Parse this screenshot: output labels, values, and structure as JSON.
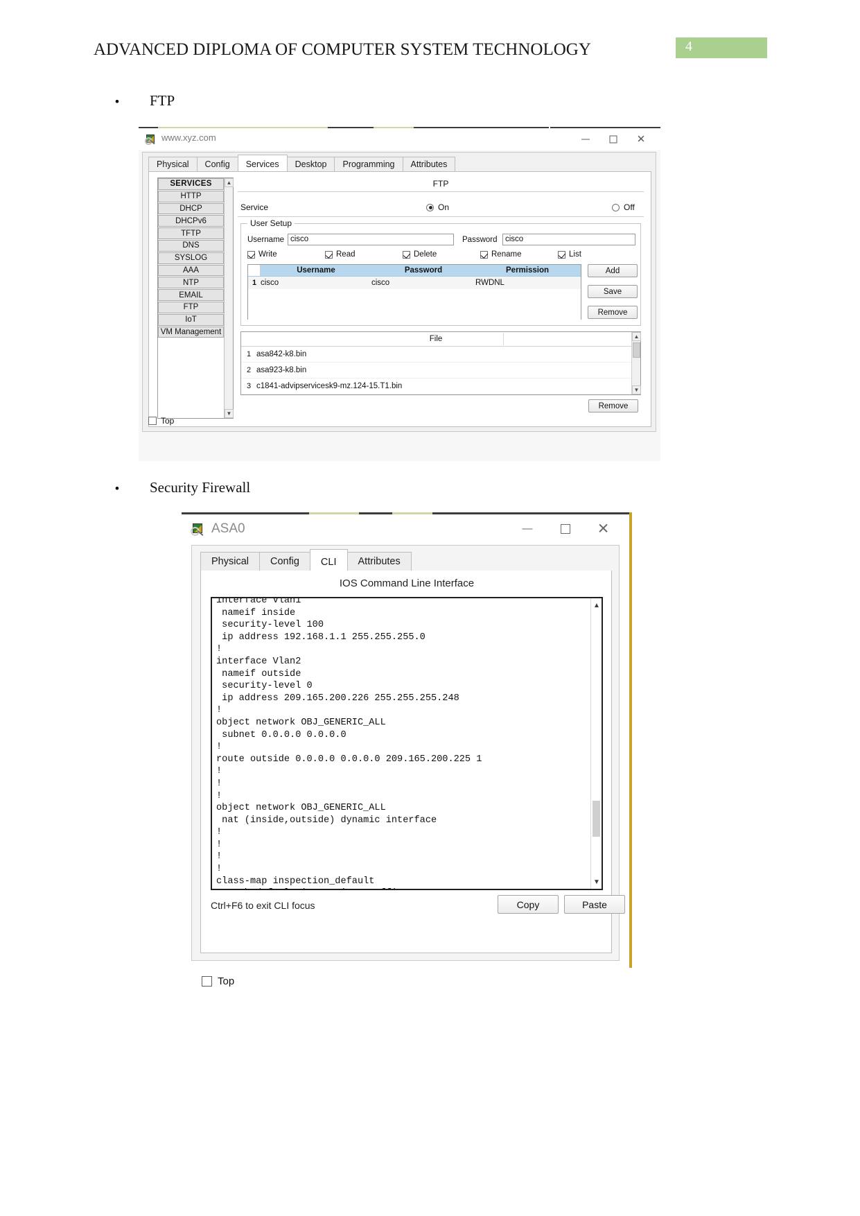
{
  "header": {
    "title": "ADVANCED DIPLOMA OF COMPUTER SYSTEM TECHNOLOGY",
    "page_number": "4",
    "badge_color": "#a9d08e"
  },
  "sections": [
    {
      "bullet": "•",
      "label": "FTP"
    },
    {
      "bullet": "•",
      "label": "Security Firewall"
    }
  ],
  "ftp_window": {
    "caption": "www.xyz.com",
    "window_buttons": {
      "minimize": "–",
      "maximize": "□",
      "close": "✕"
    },
    "tabs": [
      {
        "label": "Physical",
        "active": false
      },
      {
        "label": "Config",
        "active": false
      },
      {
        "label": "Services",
        "active": true
      },
      {
        "label": "Desktop",
        "active": false
      },
      {
        "label": "Programming",
        "active": false
      },
      {
        "label": "Attributes",
        "active": false
      }
    ],
    "services_list": [
      "SERVICES",
      "HTTP",
      "DHCP",
      "DHCPv6",
      "TFTP",
      "DNS",
      "SYSLOG",
      "AAA",
      "NTP",
      "EMAIL",
      "FTP",
      "IoT",
      "VM Management"
    ],
    "panel_title": "FTP",
    "service_label": "Service",
    "service_on": "On",
    "service_off": "Off",
    "service_state": "On",
    "user_setup": {
      "legend": "User Setup",
      "username_label": "Username",
      "username_value": "cisco",
      "password_label": "Password",
      "password_value": "cisco",
      "permissions": [
        {
          "label": "Write",
          "checked": true
        },
        {
          "label": "Read",
          "checked": true
        },
        {
          "label": "Delete",
          "checked": true
        },
        {
          "label": "Rename",
          "checked": true
        },
        {
          "label": "List",
          "checked": true
        }
      ],
      "table": {
        "headers": [
          "Username",
          "Password",
          "Permission"
        ],
        "rows": [
          {
            "n": "1",
            "username": "cisco",
            "password": "cisco",
            "permission": "RWDNL"
          }
        ]
      },
      "buttons": {
        "add": "Add",
        "save": "Save",
        "remove": "Remove"
      }
    },
    "file_list": {
      "header": "File",
      "rows": [
        {
          "n": "1",
          "file": "asa842-k8.bin"
        },
        {
          "n": "2",
          "file": "asa923-k8.bin"
        },
        {
          "n": "3",
          "file": "c1841-advipservicesk9-mz.124-15.T1.bin"
        }
      ],
      "remove_button": "Remove"
    },
    "top_checkbox": "Top"
  },
  "asa_window": {
    "caption": "ASA0",
    "window_buttons": {
      "minimize": "–",
      "maximize": "□",
      "close": "✕"
    },
    "tabs": [
      {
        "label": "Physical",
        "active": false
      },
      {
        "label": "Config",
        "active": false
      },
      {
        "label": "CLI",
        "active": true
      },
      {
        "label": "Attributes",
        "active": false
      }
    ],
    "cli_title": "IOS Command Line Interface",
    "cli_text": "interface Vlan1\n nameif inside\n security-level 100\n ip address 192.168.1.1 255.255.255.0\n!\ninterface Vlan2\n nameif outside\n security-level 0\n ip address 209.165.200.226 255.255.255.248\n!\nobject network OBJ_GENERIC_ALL\n subnet 0.0.0.0 0.0.0.0\n!\nroute outside 0.0.0.0 0.0.0.0 209.165.200.225 1\n!\n!\n!\nobject network OBJ_GENERIC_ALL\n nat (inside,outside) dynamic interface\n!\n!\n!\n!\nclass-map inspection_default\n match default-inspection-traffic",
    "cli_hint": "Ctrl+F6 to exit CLI focus",
    "copy_button": "Copy",
    "paste_button": "Paste",
    "top_checkbox": "Top"
  }
}
